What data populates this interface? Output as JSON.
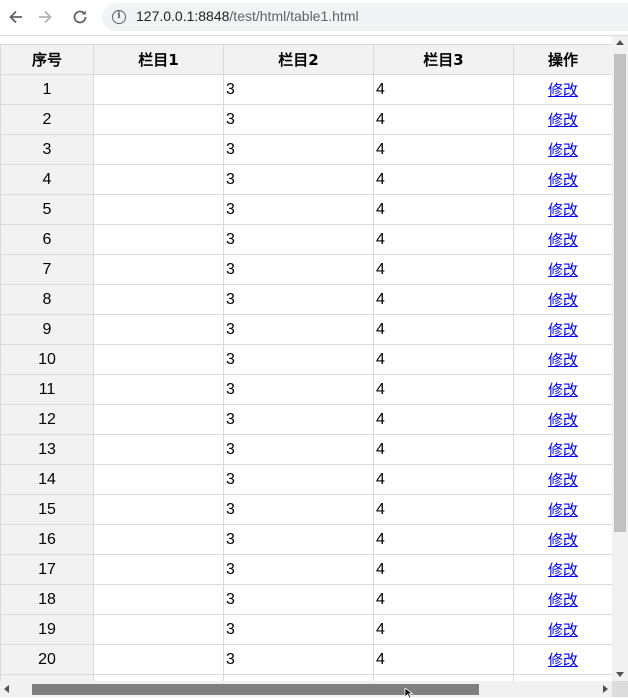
{
  "browser": {
    "url_host": "127.0.0.1:8848",
    "url_path": "/test/html/table1.html",
    "icons": {
      "back": "arrow-left-icon",
      "forward": "arrow-right-icon",
      "reload": "reload-icon",
      "info": "info-icon"
    }
  },
  "table": {
    "headers": [
      "序号",
      "栏目1",
      "栏目2",
      "栏目3",
      "操作"
    ],
    "rows": [
      {
        "idx": "1",
        "c1": "",
        "c2": "3",
        "c3": "4",
        "op": "修改"
      },
      {
        "idx": "2",
        "c1": "",
        "c2": "3",
        "c3": "4",
        "op": "修改"
      },
      {
        "idx": "3",
        "c1": "",
        "c2": "3",
        "c3": "4",
        "op": "修改"
      },
      {
        "idx": "4",
        "c1": "",
        "c2": "3",
        "c3": "4",
        "op": "修改"
      },
      {
        "idx": "5",
        "c1": "",
        "c2": "3",
        "c3": "4",
        "op": "修改"
      },
      {
        "idx": "6",
        "c1": "",
        "c2": "3",
        "c3": "4",
        "op": "修改"
      },
      {
        "idx": "7",
        "c1": "",
        "c2": "3",
        "c3": "4",
        "op": "修改"
      },
      {
        "idx": "8",
        "c1": "",
        "c2": "3",
        "c3": "4",
        "op": "修改"
      },
      {
        "idx": "9",
        "c1": "",
        "c2": "3",
        "c3": "4",
        "op": "修改"
      },
      {
        "idx": "10",
        "c1": "",
        "c2": "3",
        "c3": "4",
        "op": "修改"
      },
      {
        "idx": "11",
        "c1": "",
        "c2": "3",
        "c3": "4",
        "op": "修改"
      },
      {
        "idx": "12",
        "c1": "",
        "c2": "3",
        "c3": "4",
        "op": "修改"
      },
      {
        "idx": "13",
        "c1": "",
        "c2": "3",
        "c3": "4",
        "op": "修改"
      },
      {
        "idx": "14",
        "c1": "",
        "c2": "3",
        "c3": "4",
        "op": "修改"
      },
      {
        "idx": "15",
        "c1": "",
        "c2": "3",
        "c3": "4",
        "op": "修改"
      },
      {
        "idx": "16",
        "c1": "",
        "c2": "3",
        "c3": "4",
        "op": "修改"
      },
      {
        "idx": "17",
        "c1": "",
        "c2": "3",
        "c3": "4",
        "op": "修改"
      },
      {
        "idx": "18",
        "c1": "",
        "c2": "3",
        "c3": "4",
        "op": "修改"
      },
      {
        "idx": "19",
        "c1": "",
        "c2": "3",
        "c3": "4",
        "op": "修改"
      },
      {
        "idx": "20",
        "c1": "",
        "c2": "3",
        "c3": "4",
        "op": "修改"
      },
      {
        "idx": "",
        "c1": "",
        "c2": "",
        "c3": "",
        "op": ""
      }
    ]
  },
  "colors": {
    "header_bg": "#f2f2f2",
    "border": "#d9d9d9",
    "link": "#0000ee"
  }
}
